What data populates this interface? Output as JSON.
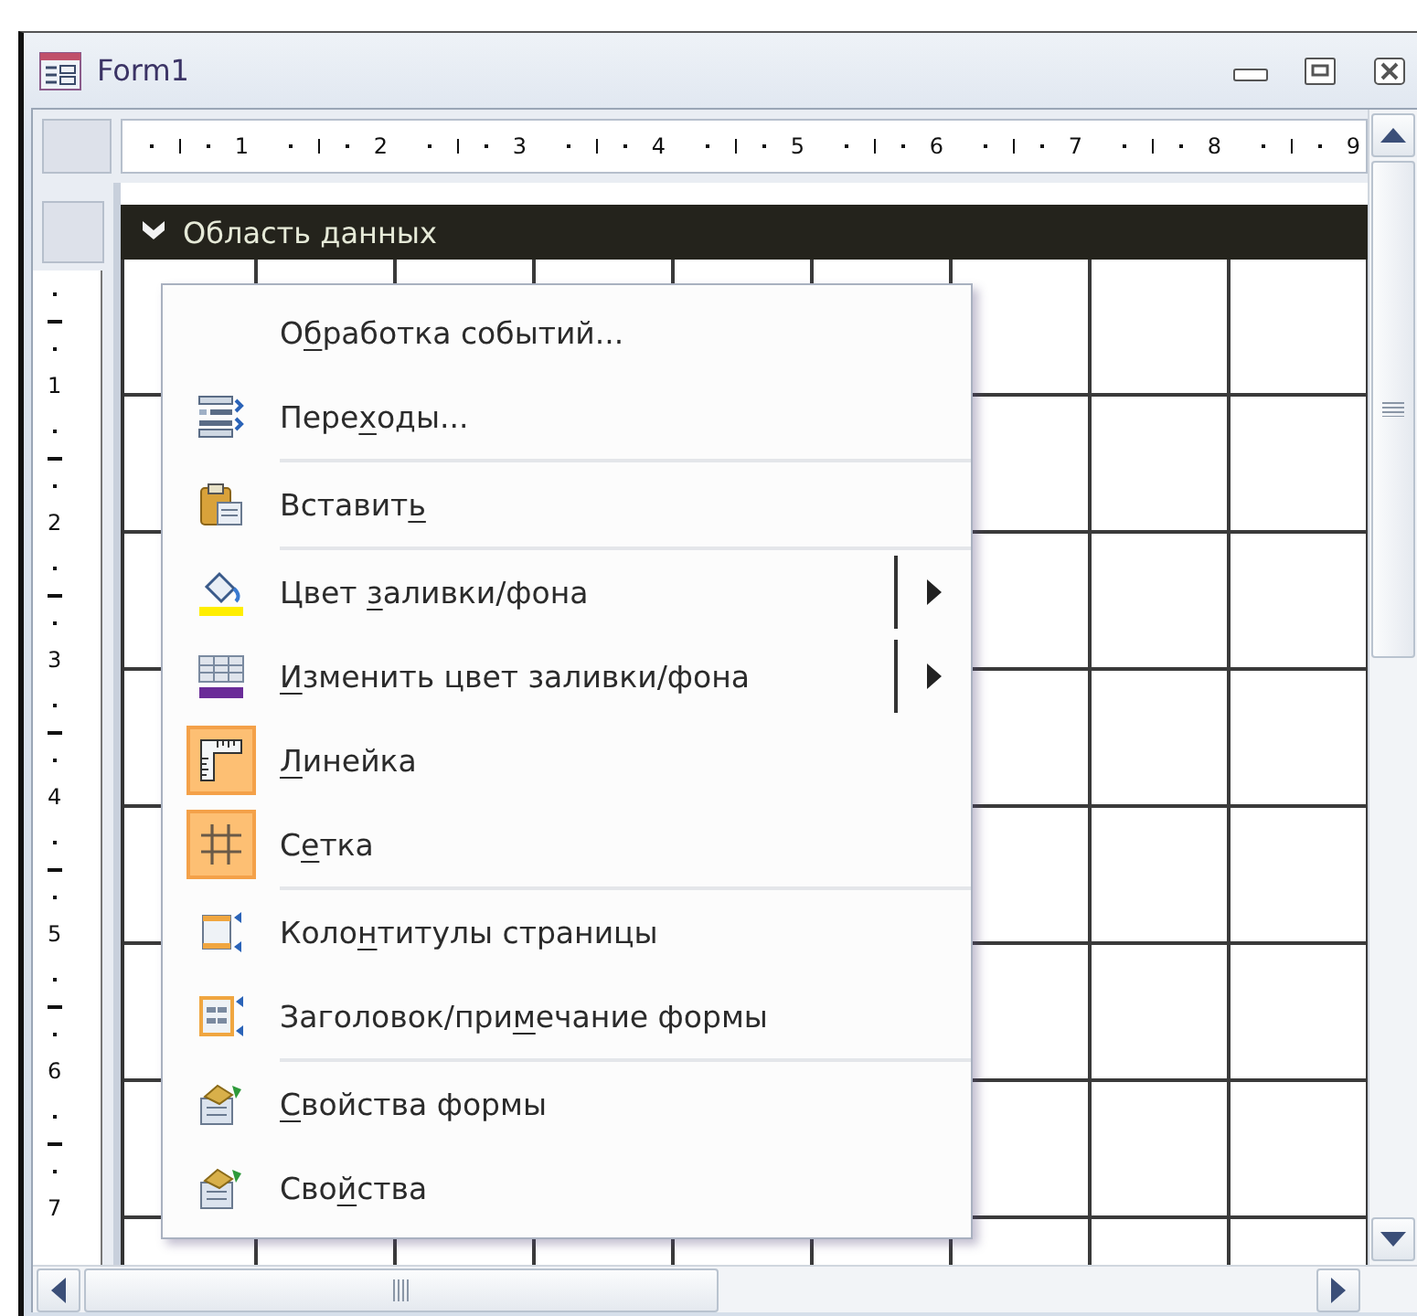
{
  "window": {
    "title": "Form1"
  },
  "ruler": {
    "horizontal_marks": [
      "1",
      "2",
      "3",
      "4",
      "5",
      "6",
      "7",
      "8",
      "9"
    ],
    "vertical_marks": [
      "1",
      "2",
      "3",
      "4",
      "5",
      "6",
      "7"
    ]
  },
  "section": {
    "title": "Область данных"
  },
  "context_menu": {
    "items": [
      {
        "pre": "О",
        "key": "б",
        "post": "работка событий...",
        "checked": false,
        "submenu": false,
        "separator_after": false
      },
      {
        "pre": "Пере",
        "key": "х",
        "post": "оды...",
        "checked": false,
        "submenu": false,
        "separator_after": true
      },
      {
        "pre": "Вставит",
        "key": "ь",
        "checked": false,
        "submenu": false,
        "separator_after": true
      },
      {
        "pre": "Цвет ",
        "key": "з",
        "post": "аливки/фона",
        "checked": false,
        "submenu": true,
        "separator_after": false
      },
      {
        "key": "И",
        "post": "зменить цвет заливки/фона",
        "checked": false,
        "submenu": true,
        "separator_after": false
      },
      {
        "key": "Л",
        "post": "инейка",
        "checked": true,
        "submenu": false,
        "separator_after": false
      },
      {
        "pre": "С",
        "key": "е",
        "post": "тка",
        "checked": true,
        "submenu": false,
        "separator_after": true
      },
      {
        "pre": "Коло",
        "key": "н",
        "post": "титулы страницы",
        "checked": false,
        "submenu": false,
        "separator_after": false
      },
      {
        "pre": "Заголовок/при",
        "key": "м",
        "post": "ечание формы",
        "checked": false,
        "submenu": false,
        "separator_after": true
      },
      {
        "key": "С",
        "post": "войства формы",
        "checked": false,
        "submenu": false,
        "separator_after": false
      },
      {
        "pre": "Сво",
        "key": "й",
        "post": "ства",
        "checked": false,
        "submenu": false,
        "separator_after": false
      }
    ]
  }
}
